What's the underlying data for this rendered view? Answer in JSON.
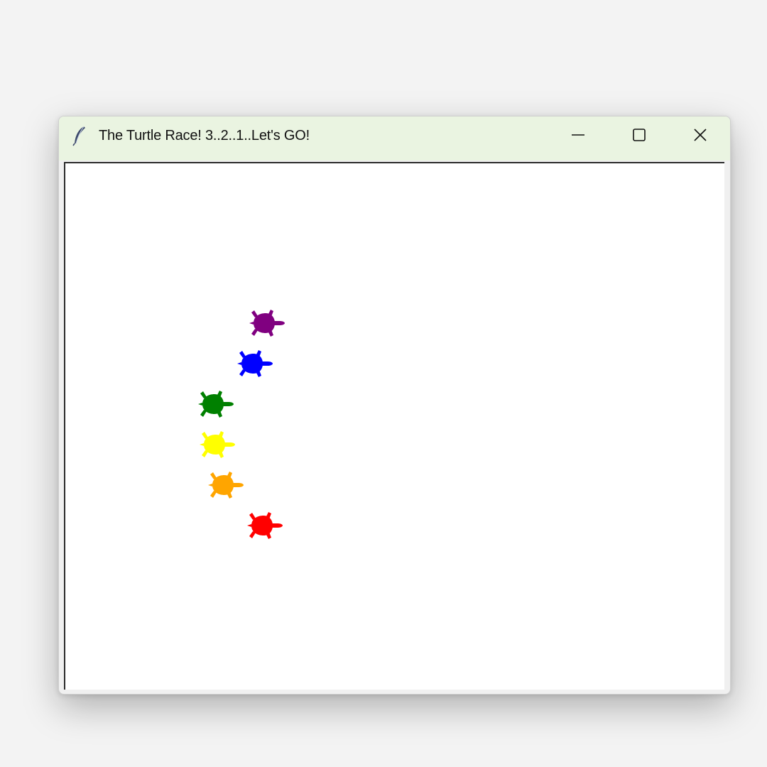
{
  "window": {
    "title": "The Turtle Race! 3..2..1..Let's GO!",
    "icon": "feather-icon",
    "controls": [
      "minimize-icon",
      "maximize-icon",
      "close-icon"
    ]
  },
  "canvas": {
    "background": "#ffffff",
    "turtles": [
      {
        "color": "purple",
        "fill": "#800080"
      },
      {
        "color": "blue",
        "fill": "#0000ff"
      },
      {
        "color": "green",
        "fill": "#008000"
      },
      {
        "color": "yellow",
        "fill": "#ffff00"
      },
      {
        "color": "orange",
        "fill": "#ffa500"
      },
      {
        "color": "red",
        "fill": "#ff0000"
      }
    ]
  }
}
